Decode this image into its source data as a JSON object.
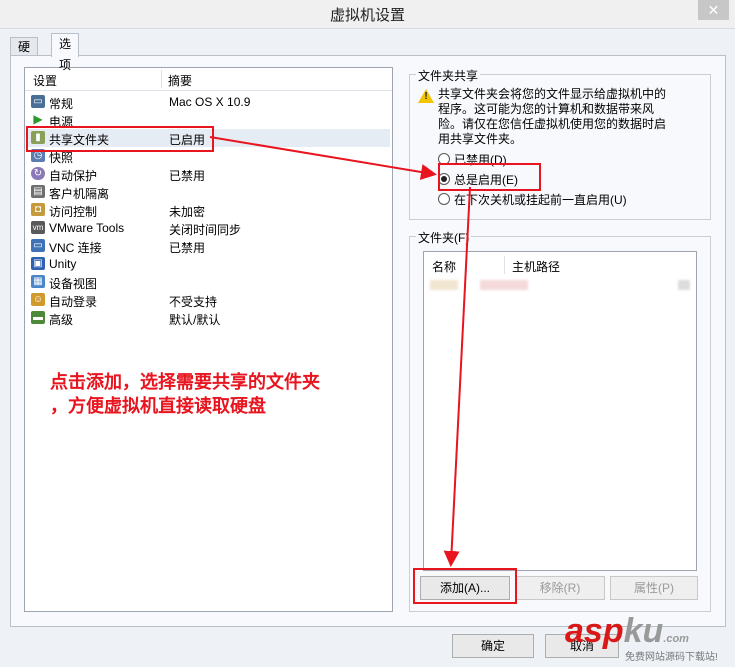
{
  "window": {
    "title": "虚拟机设置",
    "close_glyph": "✕"
  },
  "tabs": [
    {
      "label": "硬件"
    },
    {
      "label": "选项"
    }
  ],
  "settings": {
    "header": {
      "setting": "设置",
      "summary": "摘要"
    },
    "items": [
      {
        "name": "常规",
        "summary": "Mac OS X 10.9",
        "icon": "monitor-icon"
      },
      {
        "name": "电源",
        "summary": "",
        "icon": "power-play-icon"
      },
      {
        "name": "共享文件夹",
        "summary": "已启用",
        "icon": "shared-folder-icon"
      },
      {
        "name": "快照",
        "summary": "",
        "icon": "snapshot-icon"
      },
      {
        "name": "自动保护",
        "summary": "已禁用",
        "icon": "autoprotect-icon"
      },
      {
        "name": "客户机隔离",
        "summary": "",
        "icon": "isolation-icon"
      },
      {
        "name": "访问控制",
        "summary": "未加密",
        "icon": "lock-icon"
      },
      {
        "name": "VMware Tools",
        "summary": "关闭时间同步",
        "icon": "vmware-tools-icon"
      },
      {
        "name": "VNC 连接",
        "summary": "已禁用",
        "icon": "vnc-icon"
      },
      {
        "name": "Unity",
        "summary": "",
        "icon": "unity-icon"
      },
      {
        "name": "设备视图",
        "summary": "",
        "icon": "device-view-icon"
      },
      {
        "name": "自动登录",
        "summary": "不受支持",
        "icon": "users-icon"
      },
      {
        "name": "高级",
        "summary": "默认/默认",
        "icon": "advanced-icon"
      }
    ]
  },
  "sharing": {
    "group_title": "文件夹共享",
    "warning": "共享文件夹会将您的文件显示给虚拟机中的程序。这可能为您的计算机和数据带来风险。请仅在您信任虚拟机使用您的数据时启用共享文件夹。",
    "options": [
      {
        "label": "已禁用(D)",
        "checked": false
      },
      {
        "label": "总是启用(E)",
        "checked": true
      },
      {
        "label": "在下次关机或挂起前一直启用(U)",
        "checked": false
      }
    ]
  },
  "folders": {
    "group_title": "文件夹(F)",
    "columns": {
      "name": "名称",
      "host_path": "主机路径"
    },
    "buttons": {
      "add": "添加(A)...",
      "remove": "移除(R)",
      "properties": "属性(P)"
    }
  },
  "footer": {
    "ok": "确定",
    "cancel": "取消"
  },
  "annotation": {
    "line1": "点击添加，选择需要共享的文件夹",
    "line2": "，方便虚拟机直接读取硬盘"
  },
  "watermark": {
    "logo_main": "asp",
    "logo_ku": "ku",
    "logo_suffix": ".com",
    "subtitle": "免费网站源码下载站!"
  },
  "colors": {
    "accent_red": "#e8141e",
    "panel_bg": "#f7f9fc",
    "selected_row": "#e6ecf3"
  }
}
